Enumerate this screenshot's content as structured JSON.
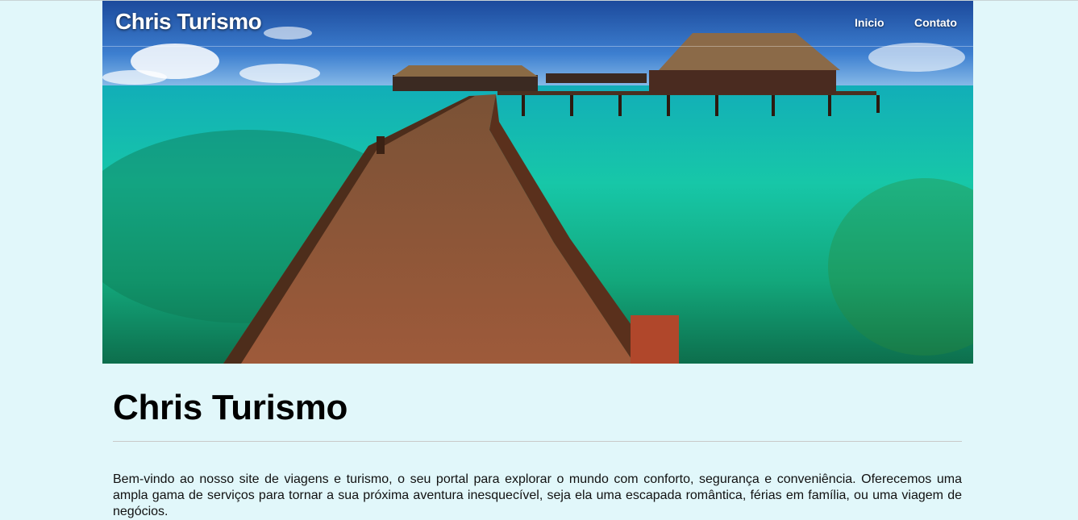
{
  "navbar": {
    "brand": "Chris Turismo",
    "links": [
      "Inicio",
      "Contato"
    ]
  },
  "hero": {
    "image_alt": "Tropical resort with overwater bungalows and wooden pier"
  },
  "main": {
    "title": "Chris Turismo",
    "intro": "Bem-vindo ao nosso site de viagens e turismo, o seu portal para explorar o mundo com conforto, segurança e conveniência. Oferecemos uma ampla gama de serviços para tornar a sua próxima aventura inesquecível, seja ela uma escapada romântica, férias em família, ou uma viagem de negócios."
  },
  "colors": {
    "page_background": "#e1f7fa",
    "nav_text": "#ffffff",
    "title_text": "#000000"
  }
}
